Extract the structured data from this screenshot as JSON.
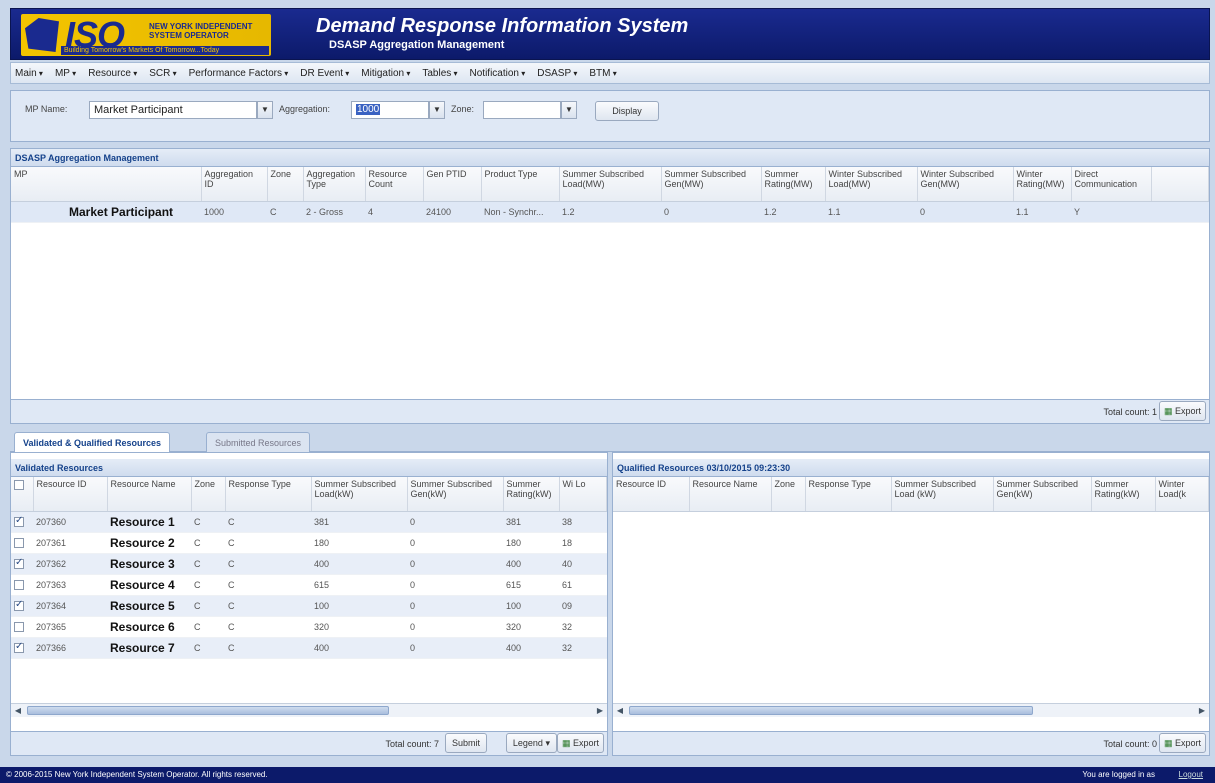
{
  "header": {
    "logo_text": "ISO",
    "logo_org": "NEW YORK INDEPENDENT SYSTEM OPERATOR",
    "logo_tagline": "Building Tomorrow's Markets Of Tomorrow...Today",
    "title": "Demand Response Information System",
    "subtitle": "DSASP Aggregation Management"
  },
  "menu": [
    "Main",
    "MP",
    "Resource",
    "SCR",
    "Performance Factors",
    "DR Event",
    "Mitigation",
    "Tables",
    "Notification",
    "DSASP",
    "BTM"
  ],
  "filter": {
    "mp_label": "MP Name:",
    "mp_value": "Market Participant",
    "agg_label": "Aggregation:",
    "agg_value": "1000",
    "zone_label": "Zone:",
    "zone_value": "",
    "display_button": "Display"
  },
  "aggregation_panel": {
    "title": "DSASP Aggregation Management",
    "columns": [
      "MP",
      "Aggregation ID",
      "Zone",
      "Aggregation Type",
      "Resource Count",
      "Gen PTID",
      "Product Type",
      "Summer Subscribed Load(MW)",
      "Summer Subscribed Gen(MW)",
      "Summer Rating(MW)",
      "Winter Subscribed Load(MW)",
      "Winter Subscribed Gen(MW)",
      "Winter Rating(MW)",
      "Direct Communication"
    ],
    "rows": [
      [
        "Market Participant",
        "1000",
        "C",
        "2 - Gross",
        "4",
        "24100",
        "Non - Synchr...",
        "1.2",
        "0",
        "1.2",
        "1.1",
        "0",
        "1.1",
        "Y"
      ]
    ],
    "total_count": "Total count: 1",
    "export_button": "Export"
  },
  "tabs": {
    "active": "Validated & Qualified Resources",
    "inactive": "Submitted Resources"
  },
  "validated_panel": {
    "title": "Validated Resources",
    "columns": [
      "",
      "Resource ID",
      "Resource Name",
      "Zone",
      "Response Type",
      "Summer Subscribed Load(kW)",
      "Summer Subscribed Gen(kW)",
      "Summer Rating(kW)",
      "Wi Lo"
    ],
    "rows": [
      {
        "checked": true,
        "cells": [
          "207360",
          "Resource 1",
          "C",
          "C",
          "381",
          "0",
          "381",
          "38"
        ]
      },
      {
        "checked": false,
        "cells": [
          "207361",
          "Resource 2",
          "C",
          "C",
          "180",
          "0",
          "180",
          "18"
        ]
      },
      {
        "checked": true,
        "cells": [
          "207362",
          "Resource 3",
          "C",
          "C",
          "400",
          "0",
          "400",
          "40"
        ]
      },
      {
        "checked": false,
        "cells": [
          "207363",
          "Resource 4",
          "C",
          "C",
          "615",
          "0",
          "615",
          "61"
        ]
      },
      {
        "checked": true,
        "cells": [
          "207364",
          "Resource 5",
          "C",
          "C",
          "100",
          "0",
          "100",
          "09"
        ]
      },
      {
        "checked": false,
        "cells": [
          "207365",
          "Resource 6",
          "C",
          "C",
          "320",
          "0",
          "320",
          "32"
        ]
      },
      {
        "checked": true,
        "cells": [
          "207366",
          "Resource 7",
          "C",
          "C",
          "400",
          "0",
          "400",
          "32"
        ]
      }
    ],
    "total_count": "Total count: 7",
    "submit_button": "Submit",
    "legend_button": "Legend",
    "export_button": "Export"
  },
  "qualified_panel": {
    "title": "Qualified Resources 03/10/2015 09:23:30",
    "columns": [
      "Resource ID",
      "Resource Name",
      "Zone",
      "Response Type",
      "Summer Subscribed Load (kW)",
      "Summer Subscribed Gen(kW)",
      "Summer Rating(kW)",
      "Winter Load(k"
    ],
    "total_count": "Total count: 0",
    "export_button": "Export"
  },
  "status": {
    "copyright": "© 2006-2015 New York Independent System Operator. All rights reserved.",
    "login_text": "You are logged in as",
    "logout": "Logout"
  }
}
